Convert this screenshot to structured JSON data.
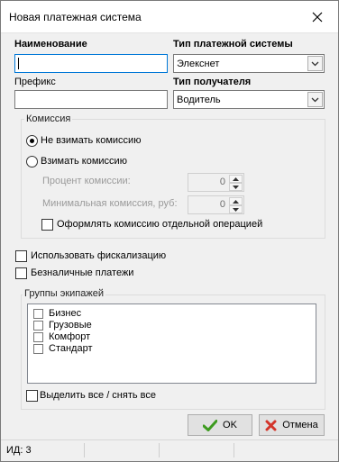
{
  "window": {
    "title": "Новая платежная система"
  },
  "fields": {
    "name_label": "Наименование",
    "name_value": "",
    "system_type_label": "Тип платежной системы",
    "system_type_value": "Элекснет",
    "prefix_label": "Префикс",
    "prefix_value": "",
    "recipient_type_label": "Тип получателя",
    "recipient_type_value": "Водитель"
  },
  "commission": {
    "group_label": "Комиссия",
    "options": [
      {
        "label": "Не взимать комиссию",
        "selected": true
      },
      {
        "label": "Взимать комиссию",
        "selected": false
      }
    ],
    "percent_label": "Процент комиссии:",
    "percent_value": "0",
    "min_label": "Минимальная комиссия, руб:",
    "min_value": "0",
    "separate_op_label": "Оформлять комиссию отдельной операцией",
    "separate_op_checked": false
  },
  "options": {
    "fiscal_label": "Использовать фискализацию",
    "fiscal_checked": false,
    "cashless_label": "Безналичные платежи",
    "cashless_checked": false
  },
  "crews": {
    "group_label": "Группы экипажей",
    "items": [
      {
        "label": "Бизнес",
        "checked": false
      },
      {
        "label": "Грузовые",
        "checked": false
      },
      {
        "label": "Комфорт",
        "checked": false
      },
      {
        "label": "Стандарт",
        "checked": false
      }
    ],
    "select_all_label": "Выделить все / снять все"
  },
  "buttons": {
    "ok_label": "OK",
    "cancel_label": "Отмена"
  },
  "status": {
    "id_text": "ИД: 3"
  },
  "colors": {
    "ok_icon": "#3d9b1f",
    "cancel_icon": "#d3342a",
    "focus": "#0078d7"
  }
}
